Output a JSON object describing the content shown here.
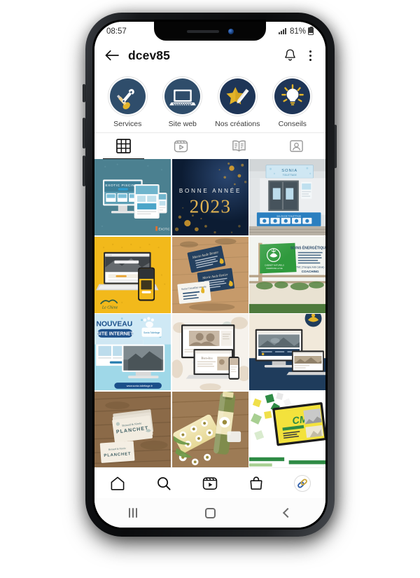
{
  "device": {
    "statusbar": {
      "time": "08:57",
      "battery_percent": "81%",
      "signal_icon": "signal-bars-icon",
      "battery_icon": "battery-icon"
    },
    "android_nav": {
      "recents": "recents-button",
      "home": "home-button",
      "back": "back-button"
    }
  },
  "header": {
    "back_icon": "back-arrow-icon",
    "title": "dcev85",
    "bell_icon": "notification-bell-icon",
    "menu_icon": "kebab-menu-icon"
  },
  "highlights": [
    {
      "label": "Services",
      "icon": "tools-icon",
      "circle_color": "#2f4d6b"
    },
    {
      "label": "Site web",
      "icon": "laptop-icon",
      "circle_color": "#2f4d6b"
    },
    {
      "label": "Nos créations",
      "icon": "star-pencil-icon",
      "circle_color": "#1e3557"
    },
    {
      "label": "Conseils",
      "icon": "lightbulb-icon",
      "circle_color": "#1e3557"
    }
  ],
  "tabs": [
    {
      "name": "grid",
      "icon": "grid-icon",
      "active": true
    },
    {
      "name": "reels",
      "icon": "reels-icon",
      "active": false
    },
    {
      "name": "guides",
      "icon": "guides-book-icon",
      "active": false
    },
    {
      "name": "tagged",
      "icon": "tagged-person-icon",
      "active": false
    }
  ],
  "grid": {
    "posts": [
      {
        "id": 1,
        "style": "exotic-piscines",
        "title": "EXOTIC PISCINES",
        "bg": "#4b8090"
      },
      {
        "id": 2,
        "style": "bonne-annee",
        "title": "BONNE ANNÉE",
        "year": "2023",
        "bg": "#10243f"
      },
      {
        "id": 3,
        "style": "shopfront",
        "title": "SONIA",
        "bg": "#d9dde0"
      },
      {
        "id": 4,
        "style": "yellow-laptop",
        "title": "",
        "bg": "#f2b91b"
      },
      {
        "id": 5,
        "style": "business-cards-navy",
        "title": "",
        "bg": "#c59b6d"
      },
      {
        "id": 6,
        "style": "green-sign",
        "title": "SOINS ÉNERGÉTIQUES",
        "subtitle": "COACHING",
        "bg": "#cfd8c8"
      },
      {
        "id": 7,
        "style": "nouveau-site",
        "title": "NOUVEAU",
        "subtitle": "SITE INTERNET",
        "bg": "#b6dff0"
      },
      {
        "id": 8,
        "style": "beige-mockup",
        "title": "",
        "bg": "#f4efe9"
      },
      {
        "id": 9,
        "style": "navy-cream-mockup",
        "title": "",
        "bg": "#f0e9dc"
      },
      {
        "id": 10,
        "style": "cards-wood",
        "title": "PLANCHET",
        "bg": "#8b6b4d"
      },
      {
        "id": 11,
        "style": "wine-labels",
        "title": "",
        "bg": "#9c7a54"
      },
      {
        "id": 12,
        "style": "cmc-green",
        "title": "CMC",
        "bg": "#ffffff"
      }
    ]
  },
  "bottom_nav": [
    {
      "name": "home",
      "icon": "home-icon"
    },
    {
      "name": "search",
      "icon": "search-icon"
    },
    {
      "name": "reels",
      "icon": "reels-icon"
    },
    {
      "name": "shop",
      "icon": "shop-bag-icon"
    },
    {
      "name": "profile",
      "icon": "profile-avatar-link-logo"
    }
  ],
  "colors": {
    "navy": "#1e3557",
    "navy_light": "#2f4d6b",
    "gold": "#e8b930",
    "white": "#ffffff"
  }
}
